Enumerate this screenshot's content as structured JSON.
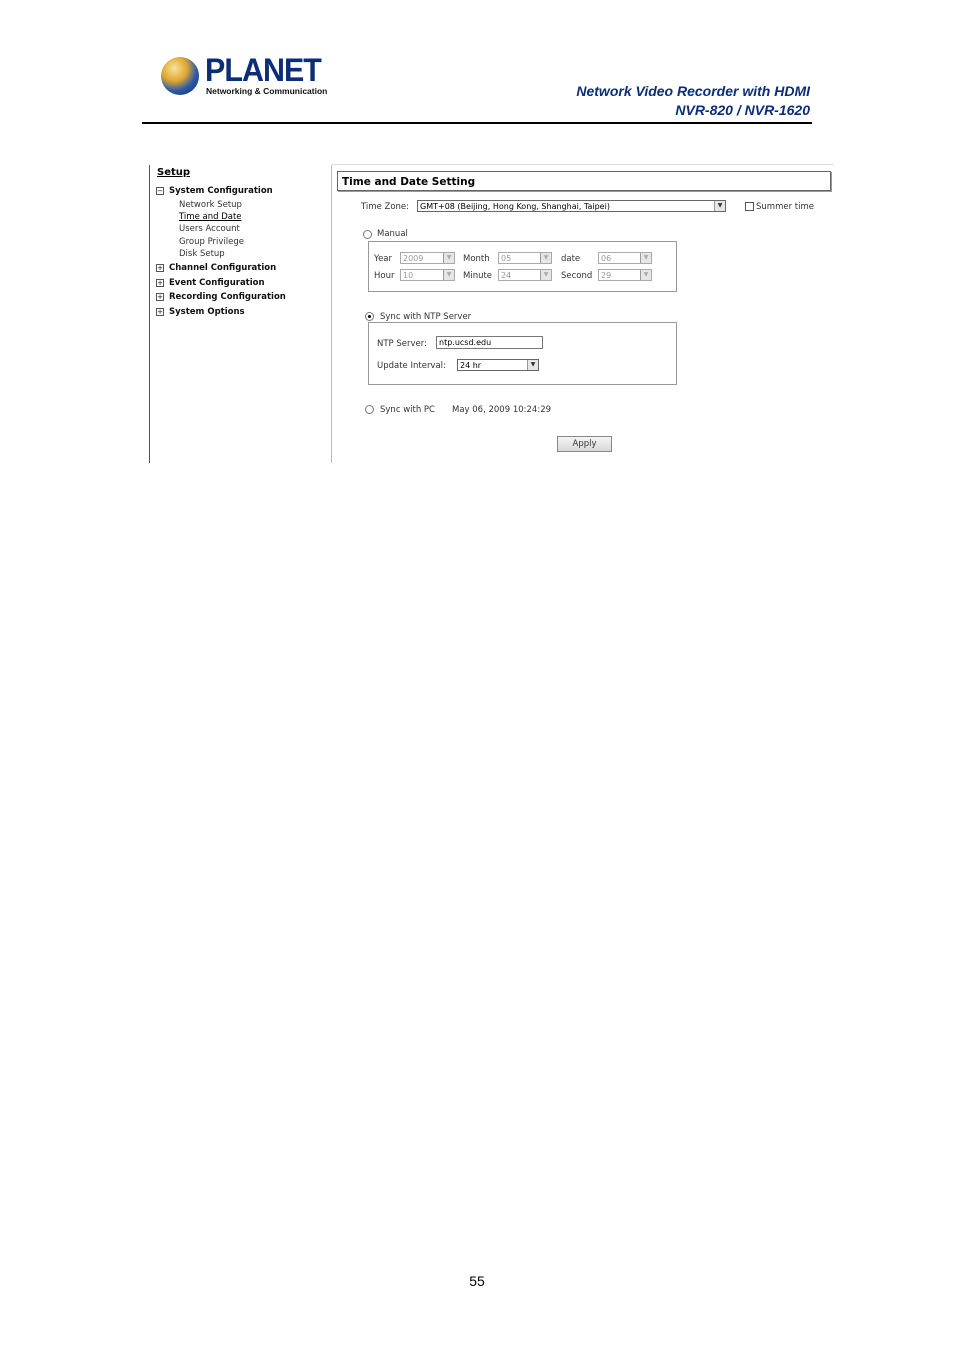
{
  "header": {
    "logo": {
      "brand": "PLANET",
      "tagline": "Networking & Communication"
    },
    "title_line1": "Network Video Recorder with HDMI",
    "title_line2": "NVR-820 / NVR-1620"
  },
  "sidebar": {
    "setup_label": "Setup",
    "sections": [
      {
        "label": "System Configuration",
        "expanded": true,
        "toggle": "⊟"
      },
      {
        "label": "Channel Configuration",
        "expanded": false,
        "toggle": "⊞"
      },
      {
        "label": "Event Configuration",
        "expanded": false,
        "toggle": "⊞"
      },
      {
        "label": "Recording Configuration",
        "expanded": false,
        "toggle": "⊞"
      },
      {
        "label": "System Options",
        "expanded": false,
        "toggle": "⊞"
      }
    ],
    "system_items": [
      "Network Setup",
      "Time and Date",
      "Users Account",
      "Group Privilege",
      "Disk Setup"
    ],
    "active_item": "Time and Date"
  },
  "panel": {
    "title": "Time and Date Setting",
    "time_zone_label": "Time Zone:",
    "time_zone_value": "GMT+08 (Beijing, Hong Kong, Shanghai, Taipei)",
    "summer_time_label": "Summer time",
    "summer_time_checked": false,
    "manual": {
      "label": "Manual",
      "selected": false,
      "year_label": "Year",
      "year": "2009",
      "month_label": "Month",
      "month": "05",
      "date_label": "date",
      "date": "06",
      "hour_label": "Hour",
      "hour": "10",
      "minute_label": "Minute",
      "minute": "24",
      "second_label": "Second",
      "second": "29"
    },
    "ntp": {
      "label": "Sync with NTP Server",
      "selected": true,
      "server_label": "NTP Server:",
      "server_value": "ntp.ucsd.edu",
      "interval_label": "Update Interval:",
      "interval_value": "24 hr"
    },
    "pc": {
      "label": "Sync with PC",
      "selected": false,
      "datetime": "May 06, 2009 10:24:29"
    },
    "apply_label": "Apply"
  },
  "footer": {
    "page_number": "55"
  },
  "icons": {
    "dropdown": "dropdown-arrow-icon",
    "expand": "plus-box-icon",
    "collapse": "minus-box-icon"
  }
}
